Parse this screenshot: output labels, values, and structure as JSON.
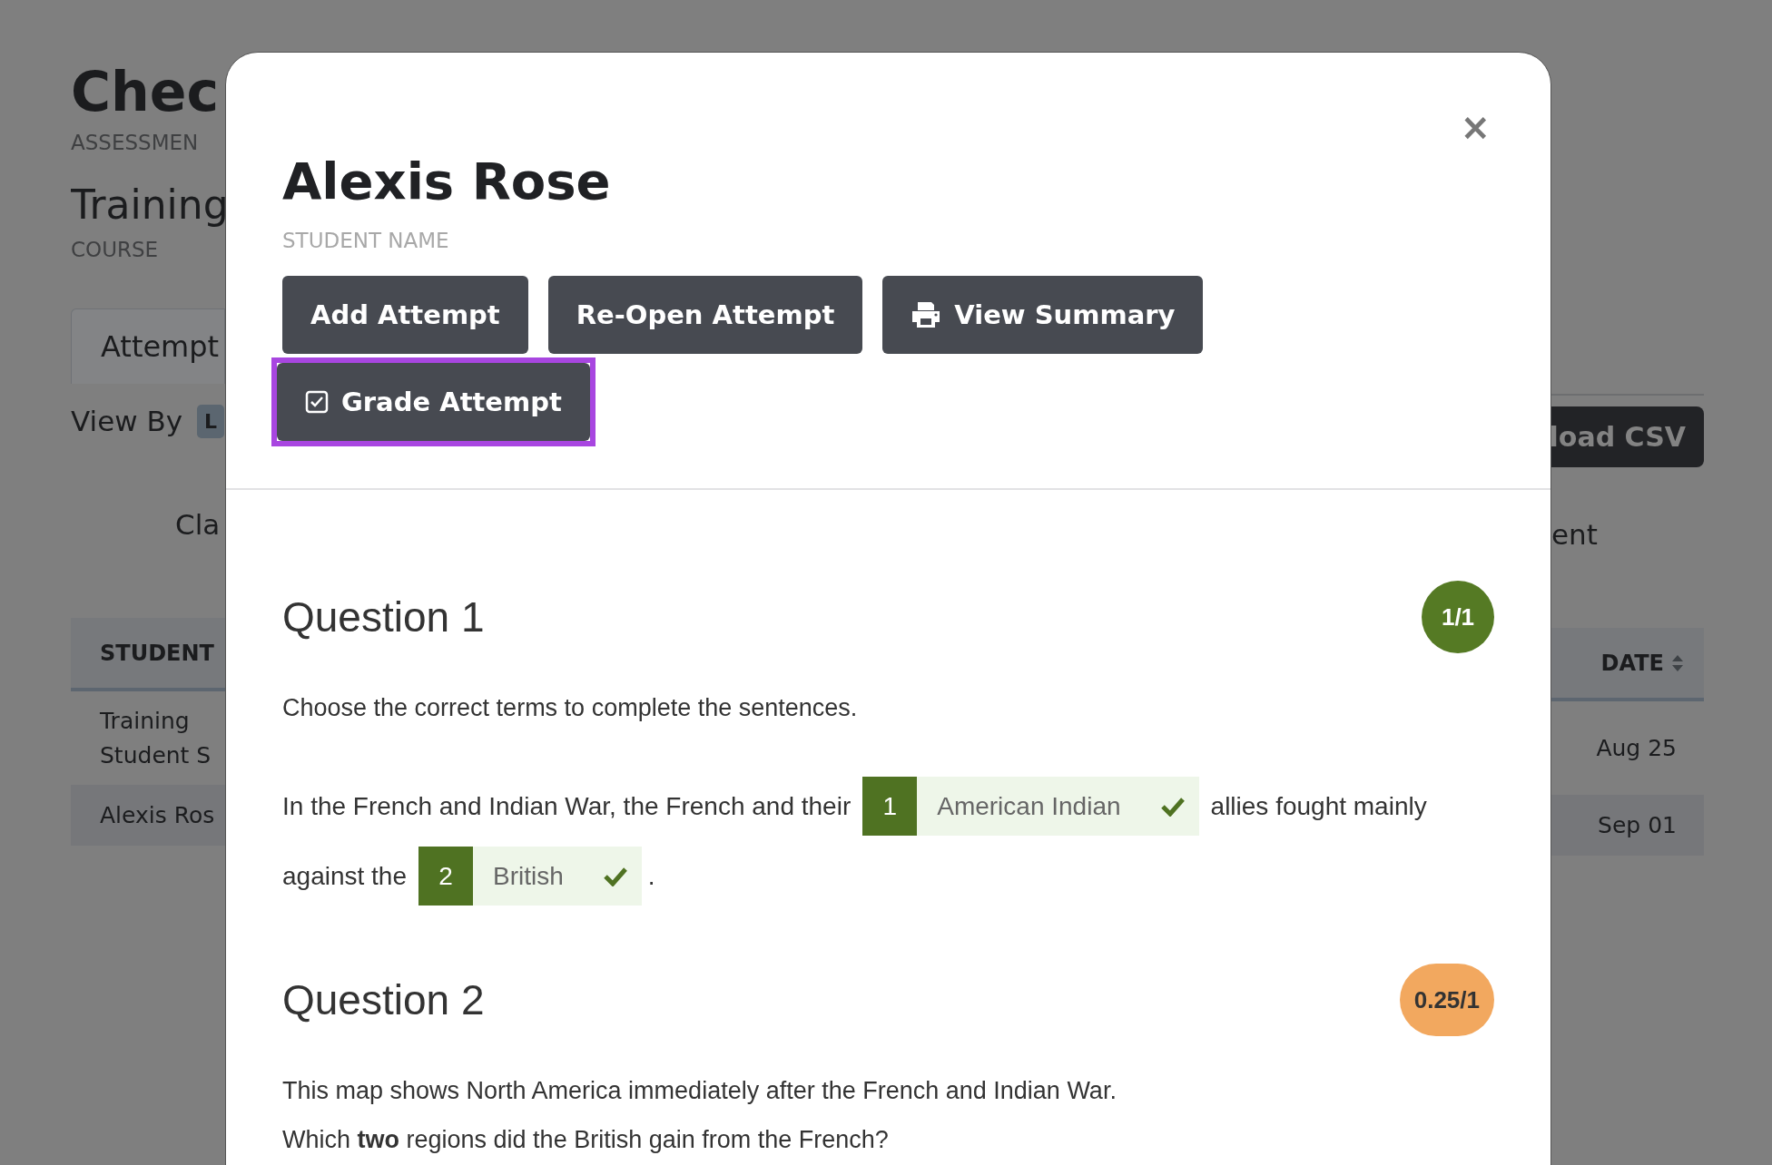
{
  "background_page": {
    "title": "Chec",
    "title_caption": "ASSESSMEN",
    "course": "Training",
    "course_caption": "COURSE",
    "tab": "Attempt",
    "view_by_label": "View By",
    "view_by_badge": "L",
    "column_label_left": "Cla",
    "column_label_right": "ent",
    "download_button": "load CSV",
    "table": {
      "columns": [
        "STUDENT",
        "DATE"
      ],
      "rows": [
        {
          "student": [
            "Training",
            "Student S"
          ],
          "date": "Aug 25"
        },
        {
          "student": [
            "Alexis Ros"
          ],
          "date": "Sep 01"
        }
      ]
    }
  },
  "modal": {
    "title": "Alexis Rose",
    "caption": "STUDENT NAME",
    "close": "×",
    "buttons": [
      {
        "label": "Add Attempt",
        "kind": "plain",
        "highlighted": false
      },
      {
        "label": "Re-Open Attempt",
        "kind": "plain",
        "highlighted": false
      },
      {
        "label": "View Summary",
        "kind": "print",
        "highlighted": false
      },
      {
        "label": "Grade Attempt",
        "kind": "grade",
        "highlighted": true
      }
    ],
    "questions": [
      {
        "title": "Question 1",
        "score": "1/1",
        "color": "#557a24",
        "prompt": [
          "Choose the correct terms to complete the sentences."
        ],
        "sentence": [
          {
            "kind": "text",
            "text": "In the French and Indian War, the French and their"
          },
          {
            "kind": "blank",
            "number": "1",
            "answer": "American Indian",
            "correct": true
          },
          {
            "kind": "text",
            "text": "allies fought mainly"
          },
          {
            "kind": "text",
            "text": "against the"
          },
          {
            "kind": "blank",
            "number": "2",
            "answer": "British",
            "correct": true
          },
          {
            "kind": "punct",
            "text": "."
          }
        ]
      },
      {
        "title": "Question 2",
        "score": "0.25/1",
        "color": "#f2a85f",
        "prompt": [
          "This map shows North America immediately after the French and Indian War.",
          "Which **two** regions did the British gain from the French?"
        ]
      }
    ]
  }
}
